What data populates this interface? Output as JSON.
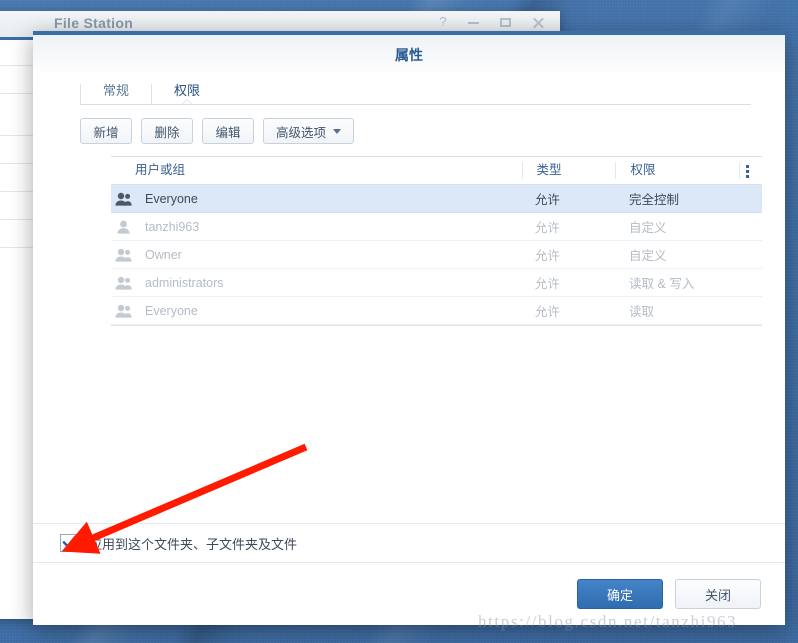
{
  "desktop": {
    "background_color": "#3f72ac"
  },
  "background_window": {
    "title": "File Station",
    "controls": [
      {
        "name": "help",
        "glyph": "?"
      },
      {
        "name": "minimize",
        "glyph": "–"
      },
      {
        "name": "maximize",
        "glyph": "□"
      },
      {
        "name": "close",
        "glyph": "✕"
      }
    ]
  },
  "dialog": {
    "title": "属性",
    "accent_color": "#3a6ea8",
    "tabs": [
      {
        "label": "常规",
        "active": false
      },
      {
        "label": "权限",
        "active": true
      }
    ],
    "toolbar": {
      "add_label": "新增",
      "delete_label": "删除",
      "edit_label": "编辑",
      "advanced_label": "高级选项"
    },
    "table": {
      "columns": [
        "用户或组",
        "类型",
        "权限"
      ],
      "menu_icon": "more-vertical-icon",
      "rows": [
        {
          "icon": "group-icon",
          "user": "Everyone",
          "type": "允许",
          "permission": "完全控制",
          "selected": true
        },
        {
          "icon": "user-icon",
          "user": "tanzhi963",
          "type": "允许",
          "permission": "自定义",
          "selected": false
        },
        {
          "icon": "group-icon",
          "user": "Owner",
          "type": "允许",
          "permission": "自定义",
          "selected": false
        },
        {
          "icon": "group-icon",
          "user": "administrators",
          "type": "允许",
          "permission": "读取 & 写入",
          "selected": false
        },
        {
          "icon": "group-icon",
          "user": "Everyone",
          "type": "允许",
          "permission": "读取",
          "selected": false
        }
      ]
    },
    "apply_checkbox": {
      "label": "应用到这个文件夹、子文件夹及文件",
      "checked": true
    },
    "buttons": {
      "confirm_label": "确定",
      "close_label": "关闭",
      "primary_color": "#2f6cb0"
    }
  },
  "annotation": {
    "arrow_color": "#ff1a00",
    "points_to": "apply-checkbox"
  },
  "watermark": {
    "text": "https://blog.csdn.net/tanzhi963"
  }
}
